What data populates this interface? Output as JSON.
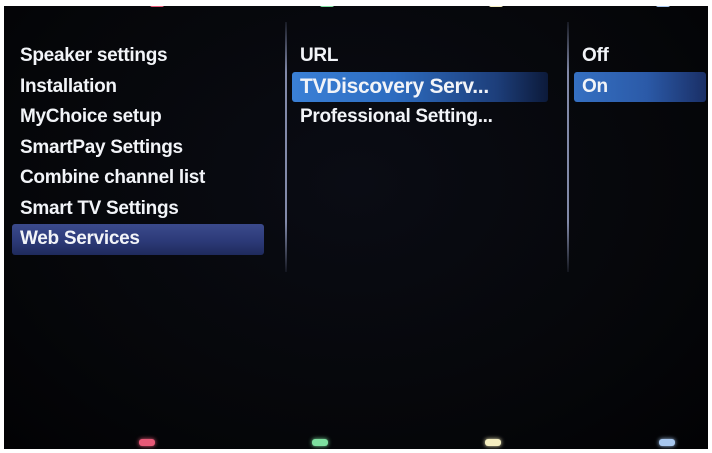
{
  "colors": {
    "key_red": "#e85a78",
    "key_green": "#7ee0a0",
    "key_yellow": "#f5eec0",
    "key_blue": "#a8c8f0",
    "selected_item_bg": "#2c3a78",
    "highlighted_item_bg": "#3a80d6",
    "text": "#f2f4f8"
  },
  "left_menu": {
    "items": [
      {
        "label": "Speaker settings"
      },
      {
        "label": "Installation"
      },
      {
        "label": "MyChoice setup"
      },
      {
        "label": "SmartPay Settings"
      },
      {
        "label": "Combine channel list"
      },
      {
        "label": "Smart TV Settings"
      },
      {
        "label": "Web Services",
        "state": "selected"
      }
    ]
  },
  "middle_menu": {
    "items": [
      {
        "label": "URL"
      },
      {
        "label": "TVDiscovery Serv...",
        "state": "highlighted"
      },
      {
        "label": "Professional Setting..."
      }
    ]
  },
  "right_menu": {
    "items": [
      {
        "label": "Off"
      },
      {
        "label": "On",
        "state": "highlighted"
      }
    ]
  },
  "color_keys": [
    "red-key",
    "green-key",
    "yellow-key",
    "blue-key"
  ]
}
